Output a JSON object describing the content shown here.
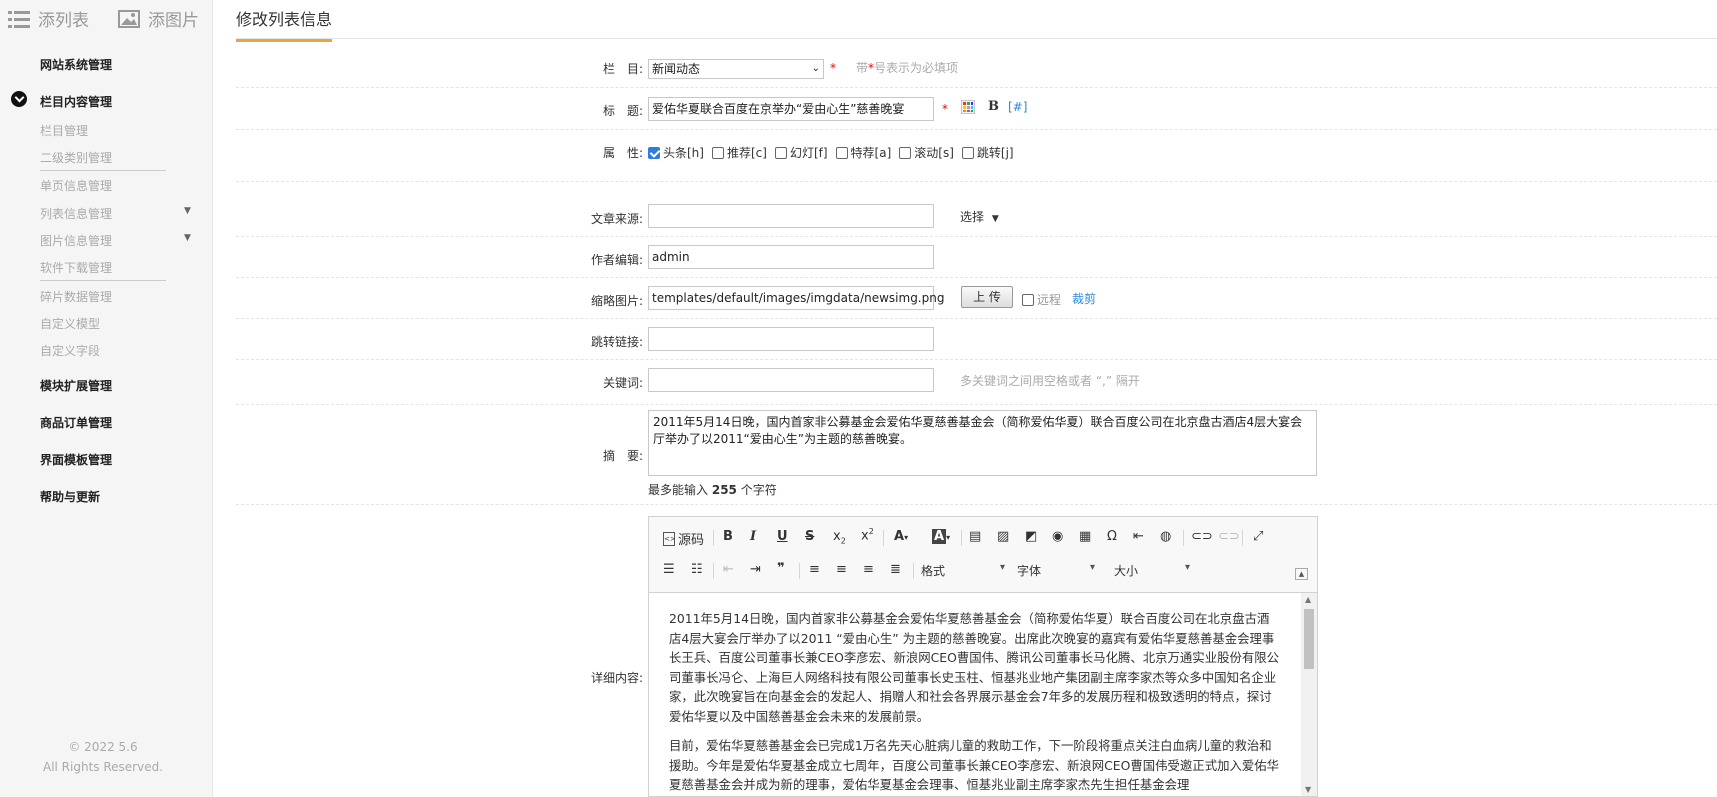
{
  "sidebar": {
    "top_buttons": [
      {
        "label": "添列表",
        "icon": "list-icon"
      },
      {
        "label": "添图片",
        "icon": "image-icon"
      }
    ],
    "groups": [
      "网站系统管理",
      "栏目内容管理",
      "模块扩展管理",
      "商品订单管理",
      "界面模板管理",
      "帮助与更新"
    ],
    "subitems": [
      "栏目管理",
      "二级类别管理",
      "单页信息管理",
      "列表信息管理",
      "图片信息管理",
      "软件下载管理",
      "碎片数据管理",
      "自定义模型",
      "自定义字段"
    ],
    "copyright": "© 2022 5.6",
    "rights": "All Rights Reserved."
  },
  "header": {
    "tab": "修改列表信息"
  },
  "form": {
    "column_label": "栏　目:",
    "column_value": "新闻动态",
    "required_star": "*",
    "required_hint_prefix": "带",
    "required_hint_suffix": "号表示为必填项",
    "title_label": "标　题:",
    "title_value": "爱佑华夏联合百度在京举办“爱由心生”慈善晚宴",
    "title_bold": "B",
    "title_hash": "[#]",
    "attr_label": "属　性:",
    "attributes": [
      {
        "label": "头条[h]",
        "checked": true
      },
      {
        "label": "推荐[c]",
        "checked": false
      },
      {
        "label": "幻灯[f]",
        "checked": false
      },
      {
        "label": "特荐[a]",
        "checked": false
      },
      {
        "label": "滚动[s]",
        "checked": false
      },
      {
        "label": "跳转[j]",
        "checked": false
      }
    ],
    "source_label": "文章来源:",
    "source_value": "",
    "source_select": "选择",
    "author_label": "作者编辑:",
    "author_value": "admin",
    "thumb_label": "缩略图片:",
    "thumb_value": "templates/default/images/imgdata/newsimg.png",
    "upload_button": "上 传",
    "remote_label": "远程",
    "crop_link": "裁剪",
    "jump_label": "跳转链接:",
    "jump_value": "",
    "keywords_label": "关键词:",
    "keywords_value": "",
    "keywords_hint": "多关键词之间用空格或者 “,” 隔开",
    "summary_label": "摘　要:",
    "summary_value": "2011年5月14日晚，国内首家非公募基金会爱佑华夏慈善基金会（简称爱佑华夏）联合百度公司在北京盘古酒店4层大宴会厅举办了以2011“爱由心生”为主题的慈善晚宴。",
    "max_prefix": "最多能输入",
    "max_count": "255",
    "max_suffix": "个字符",
    "detail_label": "详细内容:"
  },
  "editor": {
    "source_button": "源码",
    "format_combo": "格式",
    "font_combo": "字体",
    "size_combo": "大小",
    "paragraphs": [
      "2011年5月14日晚，国内首家非公募基金会爱佑华夏慈善基金会（简称爱佑华夏）联合百度公司在北京盘古酒店4层大宴会厅举办了以2011 “爱由心生” 为主题的慈善晚宴。出席此次晚宴的嘉宾有爱佑华夏慈善基金会理事长王兵、百度公司董事长兼CEO李彦宏、新浪网CEO曹国伟、腾讯公司董事长马化腾、北京万通实业股份有限公司董事长冯仑、上海巨人网络科技有限公司董事长史玉柱、恒基兆业地产集团副主席李家杰等众多中国知名企业家，此次晚宴旨在向基金会的发起人、捐赠人和社会各界展示基金会7年多的发展历程和极致透明的特点，探讨爱佑华夏以及中国慈善基金会未来的发展前景。",
      "目前，爱佑华夏慈善基金会已完成1万名先天心脏病儿童的救助工作，下一阶段将重点关注白血病儿童的救治和援助。今年是爱佑华夏基金成立七周年，百度公司董事长兼CEO李彦宏、新浪网CEO曹国伟受邀正式加入爱佑华夏慈善基金会并成为新的理事，爱佑华夏基金会理事、恒基兆业副主席李家杰先生担任基金会理"
    ]
  }
}
